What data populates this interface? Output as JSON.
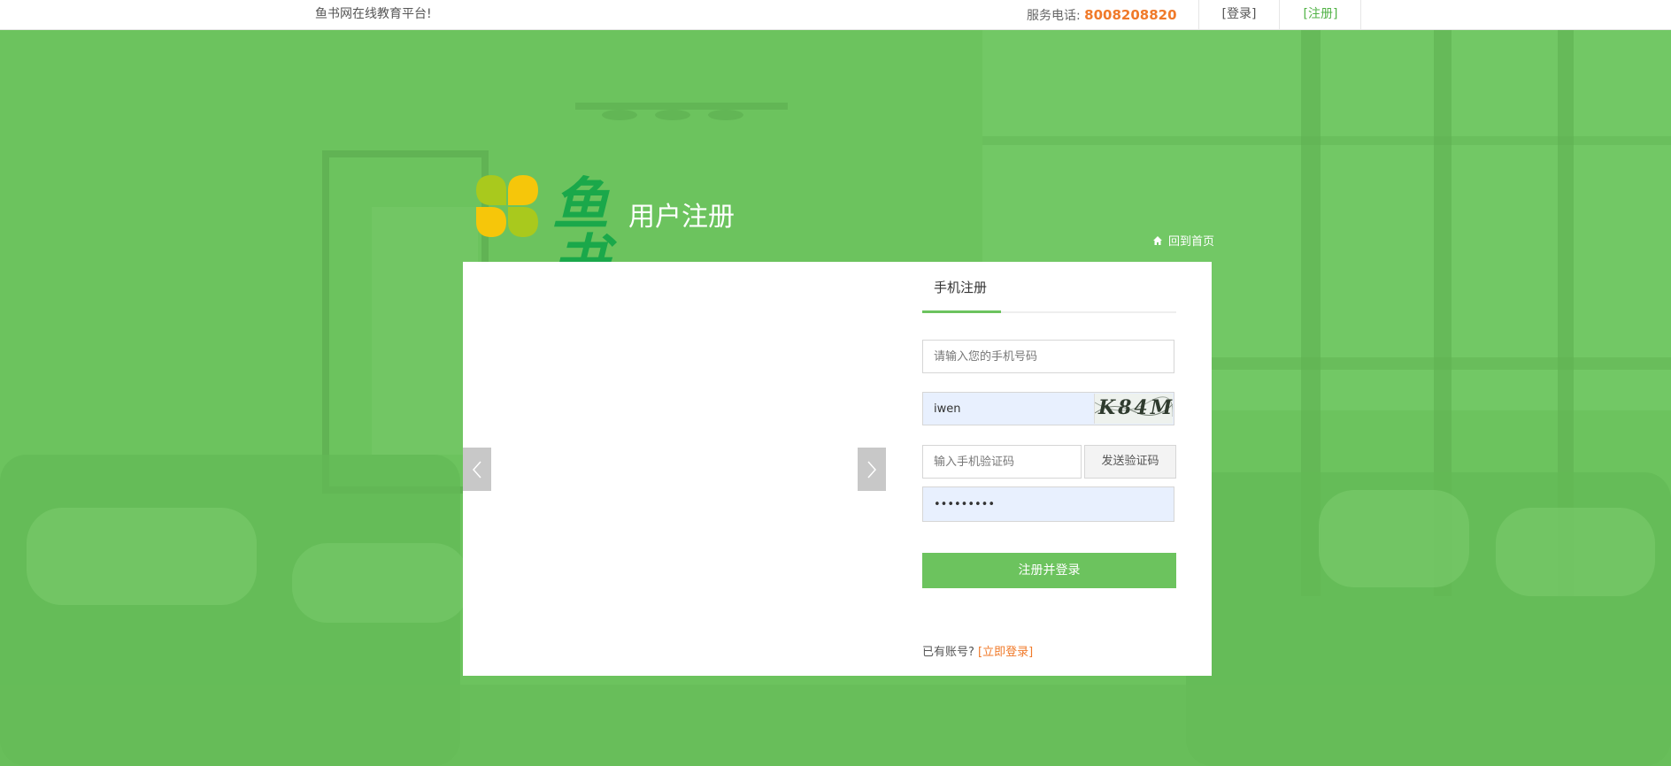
{
  "topbar": {
    "welcome": "鱼书网在线教育平台!",
    "service_label": "服务电话:",
    "service_phone": "8008208820",
    "login_link": "[登录]",
    "register_link": "[注册]"
  },
  "header": {
    "logo_text": "鱼书",
    "subtitle": "用户注册",
    "home_link": "回到首页"
  },
  "form": {
    "tab": "手机注册",
    "phone_placeholder": "请输入您的手机号码",
    "captcha_value": "iwen",
    "captcha_text": "K84M",
    "sms_placeholder": "输入手机验证码",
    "send_code_button": "发送验证码",
    "password_value": "iwen12345",
    "submit_button": "注册并登录",
    "have_account": "已有账号?",
    "login_now": "[立即登录]"
  },
  "colors": {
    "primary_green": "#6cc35e",
    "accent_orange": "#f07a2a",
    "logo_green": "#1aa84a",
    "petal_yellow": "#f6c60a",
    "petal_lime": "#a9c91d"
  },
  "icons": {
    "home": "home-icon",
    "prev": "chevron-left-icon",
    "next": "chevron-right-icon"
  }
}
